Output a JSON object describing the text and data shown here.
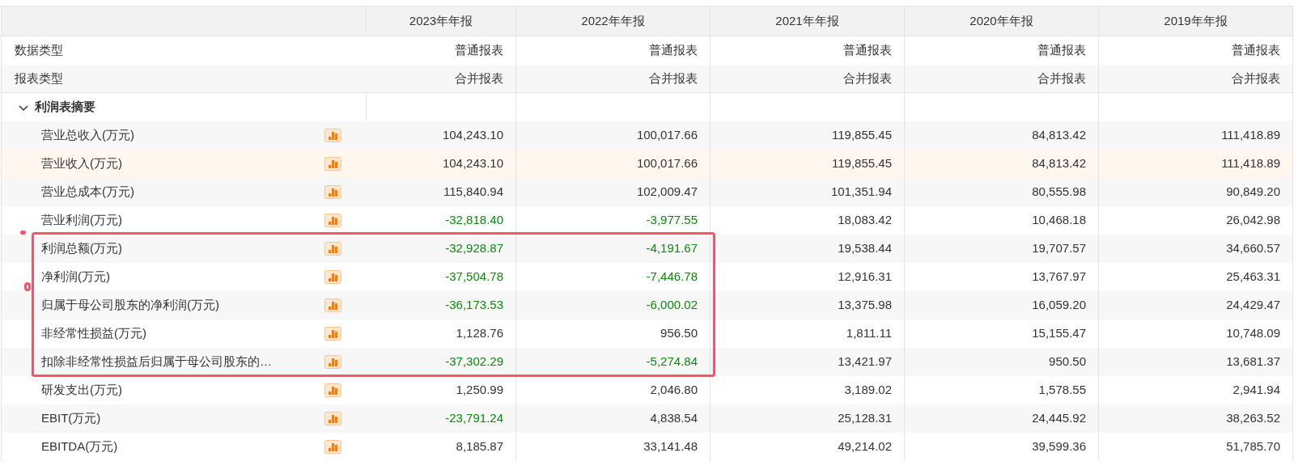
{
  "columns": [
    "2023年年报",
    "2022年年报",
    "2021年年报",
    "2020年年报",
    "2019年年报"
  ],
  "meta_rows": [
    {
      "label": "数据类型",
      "values": [
        "普通报表",
        "普通报表",
        "普通报表",
        "普通报表",
        "普通报表"
      ]
    },
    {
      "label": "报表类型",
      "values": [
        "合并报表",
        "合并报表",
        "合并报表",
        "合并报表",
        "合并报表"
      ]
    }
  ],
  "section": {
    "title": "利润表摘要",
    "expanded": true,
    "rows": [
      {
        "label": "营业总收入(万元)",
        "hovered": false,
        "highlighted": false,
        "values": [
          {
            "text": "104,243.10",
            "negative": false
          },
          {
            "text": "100,017.66",
            "negative": false
          },
          {
            "text": "119,855.45",
            "negative": false
          },
          {
            "text": "84,813.42",
            "negative": false
          },
          {
            "text": "111,418.89",
            "negative": false
          }
        ]
      },
      {
        "label": "营业收入(万元)",
        "hovered": true,
        "highlighted": false,
        "values": [
          {
            "text": "104,243.10",
            "negative": false
          },
          {
            "text": "100,017.66",
            "negative": false
          },
          {
            "text": "119,855.45",
            "negative": false
          },
          {
            "text": "84,813.42",
            "negative": false
          },
          {
            "text": "111,418.89",
            "negative": false
          }
        ]
      },
      {
        "label": "营业总成本(万元)",
        "hovered": false,
        "highlighted": false,
        "values": [
          {
            "text": "115,840.94",
            "negative": false
          },
          {
            "text": "102,009.47",
            "negative": false
          },
          {
            "text": "101,351.94",
            "negative": false
          },
          {
            "text": "80,555.98",
            "negative": false
          },
          {
            "text": "90,849.20",
            "negative": false
          }
        ]
      },
      {
        "label": "营业利润(万元)",
        "hovered": false,
        "highlighted": false,
        "values": [
          {
            "text": "-32,818.40",
            "negative": true
          },
          {
            "text": "-3,977.55",
            "negative": true
          },
          {
            "text": "18,083.42",
            "negative": false
          },
          {
            "text": "10,468.18",
            "negative": false
          },
          {
            "text": "26,042.98",
            "negative": false
          }
        ]
      },
      {
        "label": "利润总额(万元)",
        "hovered": false,
        "highlighted": true,
        "values": [
          {
            "text": "-32,928.87",
            "negative": true
          },
          {
            "text": "-4,191.67",
            "negative": true
          },
          {
            "text": "19,538.44",
            "negative": false
          },
          {
            "text": "19,707.57",
            "negative": false
          },
          {
            "text": "34,660.57",
            "negative": false
          }
        ]
      },
      {
        "label": "净利润(万元)",
        "hovered": false,
        "highlighted": true,
        "values": [
          {
            "text": "-37,504.78",
            "negative": true
          },
          {
            "text": "-7,446.78",
            "negative": true
          },
          {
            "text": "12,916.31",
            "negative": false
          },
          {
            "text": "13,767.97",
            "negative": false
          },
          {
            "text": "25,463.31",
            "negative": false
          }
        ]
      },
      {
        "label": "归属于母公司股东的净利润(万元)",
        "hovered": false,
        "highlighted": true,
        "values": [
          {
            "text": "-36,173.53",
            "negative": true
          },
          {
            "text": "-6,000.02",
            "negative": true
          },
          {
            "text": "13,375.98",
            "negative": false
          },
          {
            "text": "16,059.20",
            "negative": false
          },
          {
            "text": "24,429.47",
            "negative": false
          }
        ]
      },
      {
        "label": "非经常性损益(万元)",
        "hovered": false,
        "highlighted": true,
        "values": [
          {
            "text": "1,128.76",
            "negative": false
          },
          {
            "text": "956.50",
            "negative": false
          },
          {
            "text": "1,811.11",
            "negative": false
          },
          {
            "text": "15,155.47",
            "negative": false
          },
          {
            "text": "10,748.09",
            "negative": false
          }
        ]
      },
      {
        "label": "扣除非经常性损益后归属于母公司股东的…",
        "hovered": false,
        "highlighted": true,
        "values": [
          {
            "text": "-37,302.29",
            "negative": true
          },
          {
            "text": "-5,274.84",
            "negative": true
          },
          {
            "text": "13,421.97",
            "negative": false
          },
          {
            "text": "950.50",
            "negative": false
          },
          {
            "text": "13,681.37",
            "negative": false
          }
        ]
      },
      {
        "label": "研发支出(万元)",
        "hovered": false,
        "highlighted": false,
        "values": [
          {
            "text": "1,250.99",
            "negative": false
          },
          {
            "text": "2,046.80",
            "negative": false
          },
          {
            "text": "3,189.02",
            "negative": false
          },
          {
            "text": "1,578.55",
            "negative": false
          },
          {
            "text": "2,941.94",
            "negative": false
          }
        ]
      },
      {
        "label": "EBIT(万元)",
        "hovered": false,
        "highlighted": false,
        "values": [
          {
            "text": "-23,791.24",
            "negative": true
          },
          {
            "text": "4,838.54",
            "negative": false
          },
          {
            "text": "25,128.31",
            "negative": false
          },
          {
            "text": "24,445.92",
            "negative": false
          },
          {
            "text": "38,263.52",
            "negative": false
          }
        ]
      },
      {
        "label": "EBITDA(万元)",
        "hovered": false,
        "highlighted": false,
        "values": [
          {
            "text": "8,185.87",
            "negative": false
          },
          {
            "text": "33,141.48",
            "negative": false
          },
          {
            "text": "49,214.02",
            "negative": false
          },
          {
            "text": "39,599.36",
            "negative": false
          },
          {
            "text": "51,785.70",
            "negative": false
          }
        ]
      }
    ]
  }
}
